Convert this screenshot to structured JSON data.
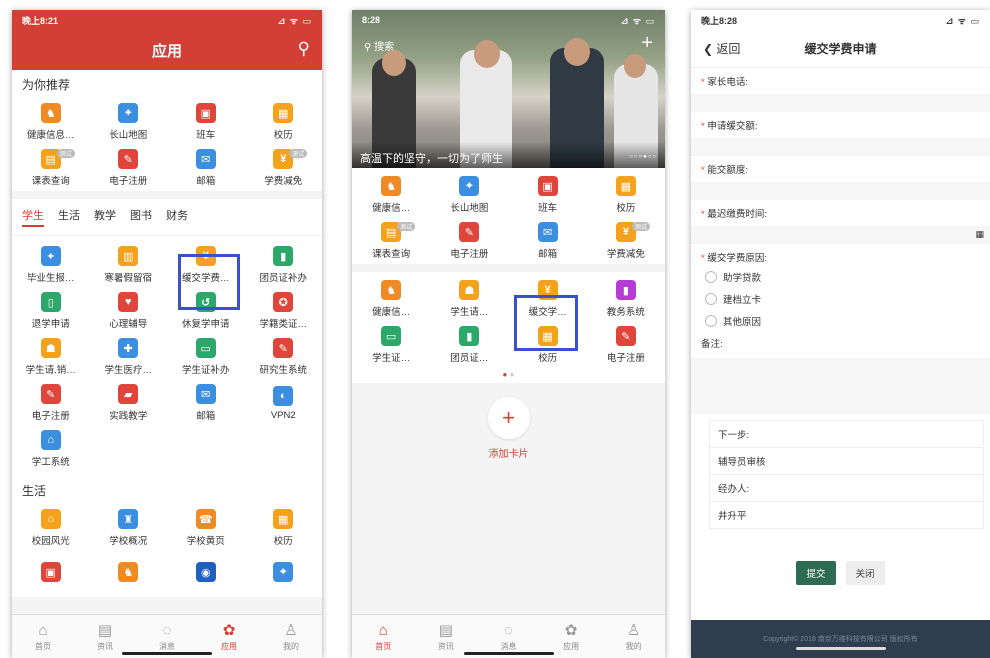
{
  "phone1": {
    "status_time": "晚上8:21",
    "status_icons": "⊿ ᯤ ▭",
    "title": "应用",
    "recommend_title": "为你推荐",
    "recommend": [
      {
        "label": "健康信息…",
        "icon": "doctor-icon",
        "color": "#f08a24"
      },
      {
        "label": "长山地图",
        "icon": "map-icon",
        "color": "#3c8ee0"
      },
      {
        "label": "班车",
        "icon": "bus-icon",
        "color": "#e0453b"
      },
      {
        "label": "校历",
        "icon": "calendar-icon",
        "color": "#f4a21c"
      },
      {
        "label": "课表查询",
        "icon": "timetable-icon",
        "color": "#f4a21c",
        "badge": "测试"
      },
      {
        "label": "电子注册",
        "icon": "register-icon",
        "color": "#e0453b"
      },
      {
        "label": "邮箱",
        "icon": "mail-icon",
        "color": "#3c8ee0"
      },
      {
        "label": "学费减免",
        "icon": "tuition-icon",
        "color": "#f4a21c",
        "badge": "测试"
      }
    ],
    "tabs": [
      "学生",
      "生活",
      "教学",
      "图书",
      "财务"
    ],
    "student": [
      {
        "label": "毕业生报…",
        "icon": "graduate-icon",
        "color": "#3c8ee0"
      },
      {
        "label": "寒暑假留宿",
        "icon": "dorm-icon",
        "color": "#f4a21c"
      },
      {
        "label": "缓交学费…",
        "icon": "defer-fee-icon",
        "color": "#f4a21c"
      },
      {
        "label": "团员证补办",
        "icon": "member-card-icon",
        "color": "#2da86b"
      },
      {
        "label": "退学申请",
        "icon": "withdraw-icon",
        "color": "#2da86b"
      },
      {
        "label": "心理辅导",
        "icon": "heart-icon",
        "color": "#e0453b"
      },
      {
        "label": "休复学申请",
        "icon": "resume-icon",
        "color": "#2da86b"
      },
      {
        "label": "学籍类证…",
        "icon": "certificate-icon",
        "color": "#e0453b"
      },
      {
        "label": "学生请.销…",
        "icon": "leave-icon",
        "color": "#f4a21c"
      },
      {
        "label": "学生医疗…",
        "icon": "medical-icon",
        "color": "#3c8ee0"
      },
      {
        "label": "学生证补办",
        "icon": "student-card-icon",
        "color": "#2da86b"
      },
      {
        "label": "研究生系统",
        "icon": "postgrad-icon",
        "color": "#e0453b"
      },
      {
        "label": "电子注册",
        "icon": "register-icon",
        "color": "#e0453b"
      },
      {
        "label": "实践教学",
        "icon": "book-icon",
        "color": "#e0453b"
      },
      {
        "label": "邮箱",
        "icon": "mail-icon",
        "color": "#3c8ee0"
      },
      {
        "label": "VPN2",
        "icon": "vpn-icon",
        "color": "#3c8ee0"
      },
      {
        "label": "学工系统",
        "icon": "school-icon",
        "color": "#3c8ee0"
      }
    ],
    "life_title": "生活",
    "life": [
      {
        "label": "校园风光",
        "icon": "campus-icon",
        "color": "#f4a21c"
      },
      {
        "label": "学校概况",
        "icon": "school-info-icon",
        "color": "#3c8ee0"
      },
      {
        "label": "学校黄页",
        "icon": "phone-book-icon",
        "color": "#f08a24"
      },
      {
        "label": "校历",
        "icon": "calendar-icon",
        "color": "#f4a21c"
      },
      {
        "label": "",
        "icon": "bus-icon",
        "color": "#e0453b"
      },
      {
        "label": "",
        "icon": "doctor-icon",
        "color": "#f08a24"
      },
      {
        "label": "",
        "icon": "compass-icon",
        "color": "#1f5fbf"
      },
      {
        "label": "",
        "icon": "map-icon",
        "color": "#3c8ee0"
      }
    ],
    "nav": [
      {
        "label": "首页",
        "icon": "⌂"
      },
      {
        "label": "资讯",
        "icon": "▤"
      },
      {
        "label": "消息",
        "icon": "◌"
      },
      {
        "label": "应用",
        "icon": "✿"
      },
      {
        "label": "我的",
        "icon": "♙"
      }
    ]
  },
  "phone2": {
    "status_time": "8:28",
    "search_label": "搜索",
    "banner_caption": "高温下的坚守，一切为了师生",
    "banner_dots": "○○○●○○",
    "grid1": [
      {
        "label": "健康信…",
        "icon": "doctor-icon",
        "color": "#f08a24"
      },
      {
        "label": "长山地图",
        "icon": "map-icon",
        "color": "#3c8ee0"
      },
      {
        "label": "班车",
        "icon": "bus-icon",
        "color": "#e0453b"
      },
      {
        "label": "校历",
        "icon": "calendar-icon",
        "color": "#f4a21c"
      },
      {
        "label": "课表查询",
        "icon": "timetable-icon",
        "color": "#f4a21c",
        "badge": "测试"
      },
      {
        "label": "电子注册",
        "icon": "register-icon",
        "color": "#e0453b"
      },
      {
        "label": "邮箱",
        "icon": "mail-icon",
        "color": "#3c8ee0"
      },
      {
        "label": "学费减免",
        "icon": "tuition-icon",
        "color": "#f4a21c",
        "badge": "测试"
      }
    ],
    "grid2": [
      {
        "label": "健康信…",
        "icon": "doctor-icon",
        "color": "#f08a24"
      },
      {
        "label": "学生请…",
        "icon": "leave-icon",
        "color": "#f4a21c"
      },
      {
        "label": "缓交学…",
        "icon": "defer-fee-icon",
        "color": "#f4a21c"
      },
      {
        "label": "教务系统",
        "icon": "academic-icon",
        "color": "#b53dd6"
      },
      {
        "label": "学生证…",
        "icon": "student-card-icon",
        "color": "#2da86b"
      },
      {
        "label": "团员证…",
        "icon": "member-card-icon",
        "color": "#2da86b"
      },
      {
        "label": "校历",
        "icon": "calendar-icon",
        "color": "#f4a21c"
      },
      {
        "label": "电子注册",
        "icon": "register-icon",
        "color": "#e0453b"
      }
    ],
    "add_card": "添加卡片",
    "nav": [
      {
        "label": "首页",
        "icon": "⌂"
      },
      {
        "label": "资讯",
        "icon": "▤"
      },
      {
        "label": "消息",
        "icon": "◌"
      },
      {
        "label": "应用",
        "icon": "✿"
      },
      {
        "label": "我的",
        "icon": "♙"
      }
    ]
  },
  "phone3": {
    "status_time": "晚上8:28",
    "back_label": "返回",
    "title": "缓交学费申请",
    "f1": "家长电话:",
    "f2": "申请缓交额:",
    "f3": "能交额度:",
    "f4": "最迟缴费时间:",
    "f5": "缓交学费原因:",
    "options": [
      "助学贷款",
      "建档立卡",
      "其他原因"
    ],
    "remarks": "备注:",
    "flow": [
      "下一步:",
      "辅导员审核",
      "经办人:",
      "井升平"
    ],
    "submit": "提交",
    "close": "关闭",
    "copyright": "Copyright© 2018 南京万维科技有限公司 版权所有"
  }
}
